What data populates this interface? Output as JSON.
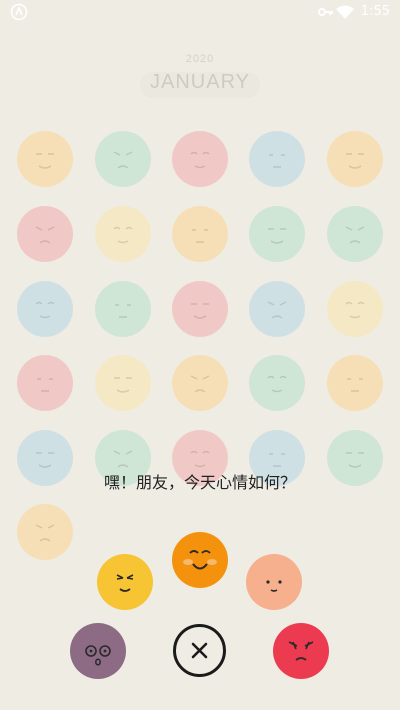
{
  "status_bar": {
    "time": "1:55",
    "icons": [
      "app-notification-icon",
      "key-icon",
      "wifi-icon"
    ]
  },
  "calendar": {
    "year": "2020",
    "month": "JANUARY",
    "day_colors": [
      "#f6dfb7",
      "#cfe5d5",
      "#f0c9c6",
      "#cfe0e4",
      "#f6dfb7",
      "#f0c9c6",
      "#f5e8c4",
      "#f6dfb7",
      "#cfe5d5",
      "#cfe5d5",
      "#cfe0e4",
      "#cfe5d5",
      "#f0c9c6",
      "#cfe0e4",
      "#f5e8c4",
      "#f0c9c6",
      "#f5e8c4",
      "#f6dfb7",
      "#cfe5d5",
      "#f6dfb7",
      "#cfe0e4",
      "#cfe5d5",
      "#f0c9c6",
      "#cfe0e4",
      "#cfe5d5",
      "#f6dfb7"
    ]
  },
  "prompt": "嘿！朋友，今天心情如何？",
  "moods": [
    {
      "name": "cool",
      "color": "#f7c434"
    },
    {
      "name": "happy",
      "color": "#f4920d"
    },
    {
      "name": "shy",
      "color": "#f6b08e"
    },
    {
      "name": "dizzy",
      "color": "#8d6b85"
    },
    {
      "name": "angry",
      "color": "#ec3b51"
    }
  ],
  "close_icon": "close-x-icon"
}
